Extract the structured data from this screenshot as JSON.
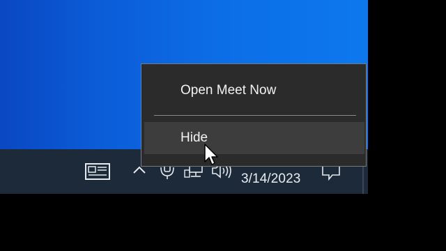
{
  "taskbar": {
    "date": "3/14/2023",
    "icons": [
      "news-and-interests-icon",
      "chevron-up-icon",
      "meet-now-icon",
      "network-icon",
      "volume-icon",
      "notification-icon"
    ]
  },
  "context_menu": {
    "items": [
      {
        "label": "Open Meet Now"
      },
      {
        "label": "Hide",
        "hovered": true
      }
    ]
  },
  "colors": {
    "desktop": "#0c6ee6",
    "taskbar": "#1d2a3a",
    "menu_bg": "#2b2b2b",
    "menu_hover": "#3d3d3d",
    "menu_text": "#f2f2f2"
  }
}
